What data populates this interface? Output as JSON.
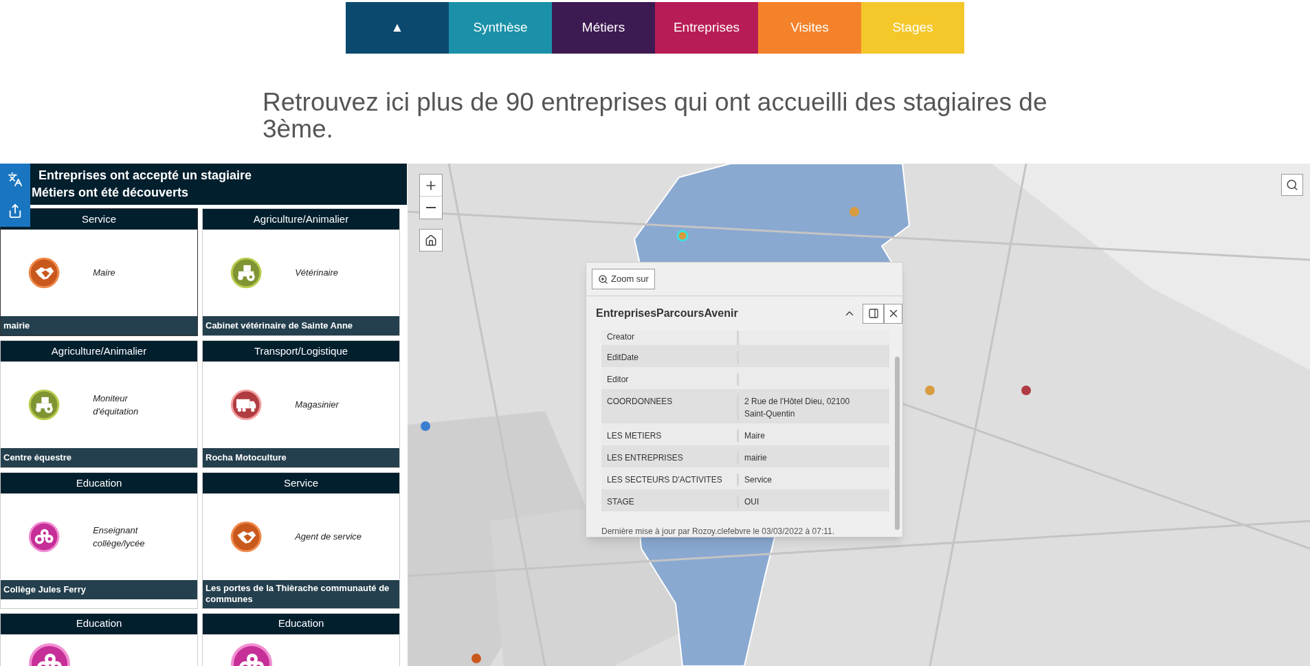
{
  "nav": {
    "tabs": [
      {
        "label": "▲",
        "color": "#0b4a6e"
      },
      {
        "label": "Synthèse",
        "color": "#1a91a8"
      },
      {
        "label": "Métiers",
        "color": "#3d1a52"
      },
      {
        "label": "Entreprises",
        "color": "#b81c56"
      },
      {
        "label": "Visites",
        "color": "#f3822a"
      },
      {
        "label": "Stages",
        "color": "#f4c72b"
      }
    ]
  },
  "intro": "Retrouvez ici plus de 90 entreprises qui ont accueilli des stagiaires de 3ème.",
  "panel": {
    "title_lines": [
      "Entreprises ont accepté un stagiaire",
      "Métiers ont été découverts"
    ],
    "cards": [
      {
        "sector": "Service",
        "kind": "handshake",
        "metier": "Maire",
        "entreprise": "mairie",
        "selected": true
      },
      {
        "sector": "Agriculture/Animalier",
        "kind": "tractor",
        "metier": "Vétérinaire",
        "entreprise": "Cabinet vétérinaire de Sainte Anne",
        "selected": false
      },
      {
        "sector": "Agriculture/Animalier",
        "kind": "tractor",
        "metier": "Moniteur d'équitation",
        "entreprise": "Centre équestre",
        "selected": false
      },
      {
        "sector": "Transport/Logistique",
        "kind": "truck",
        "metier": "Magasinier",
        "entreprise": "Rocha Motoculture",
        "selected": false
      },
      {
        "sector": "Education",
        "kind": "letters",
        "metier": "Enseignant collège/lycée",
        "entreprise": "Collège Jules Ferry",
        "selected": false
      },
      {
        "sector": "Service",
        "kind": "handshake",
        "metier": "Agent de service",
        "entreprise": "Les portes de la Thièrache communauté de communes",
        "selected": false
      },
      {
        "sector": "Education",
        "kind": "letters",
        "selected": false
      },
      {
        "sector": "Education",
        "kind": "letters",
        "selected": false
      }
    ]
  },
  "popup": {
    "zoom_button": "Zoom sur",
    "title": "EntreprisesParcoursAvenir",
    "fields": [
      {
        "label": "Creator"
      },
      {
        "label": "EditDate"
      },
      {
        "label": "Editor"
      },
      {
        "label": "COORDONNEES",
        "value": "2 Rue de l'Hôtel Dieu, 02100 Saint-Quentin"
      },
      {
        "label": "LES METIERS",
        "value": "Maire"
      },
      {
        "label": "LES ENTREPRISES",
        "value": "mairie"
      },
      {
        "label": "LES SECTEURS D'ACTIVITES",
        "value": "Service"
      },
      {
        "label": "STAGE",
        "value": "OUI"
      }
    ],
    "footer": "Dernière mise à jour par Rozoy.clefebvre le 03/03/2022 à 07:11."
  }
}
